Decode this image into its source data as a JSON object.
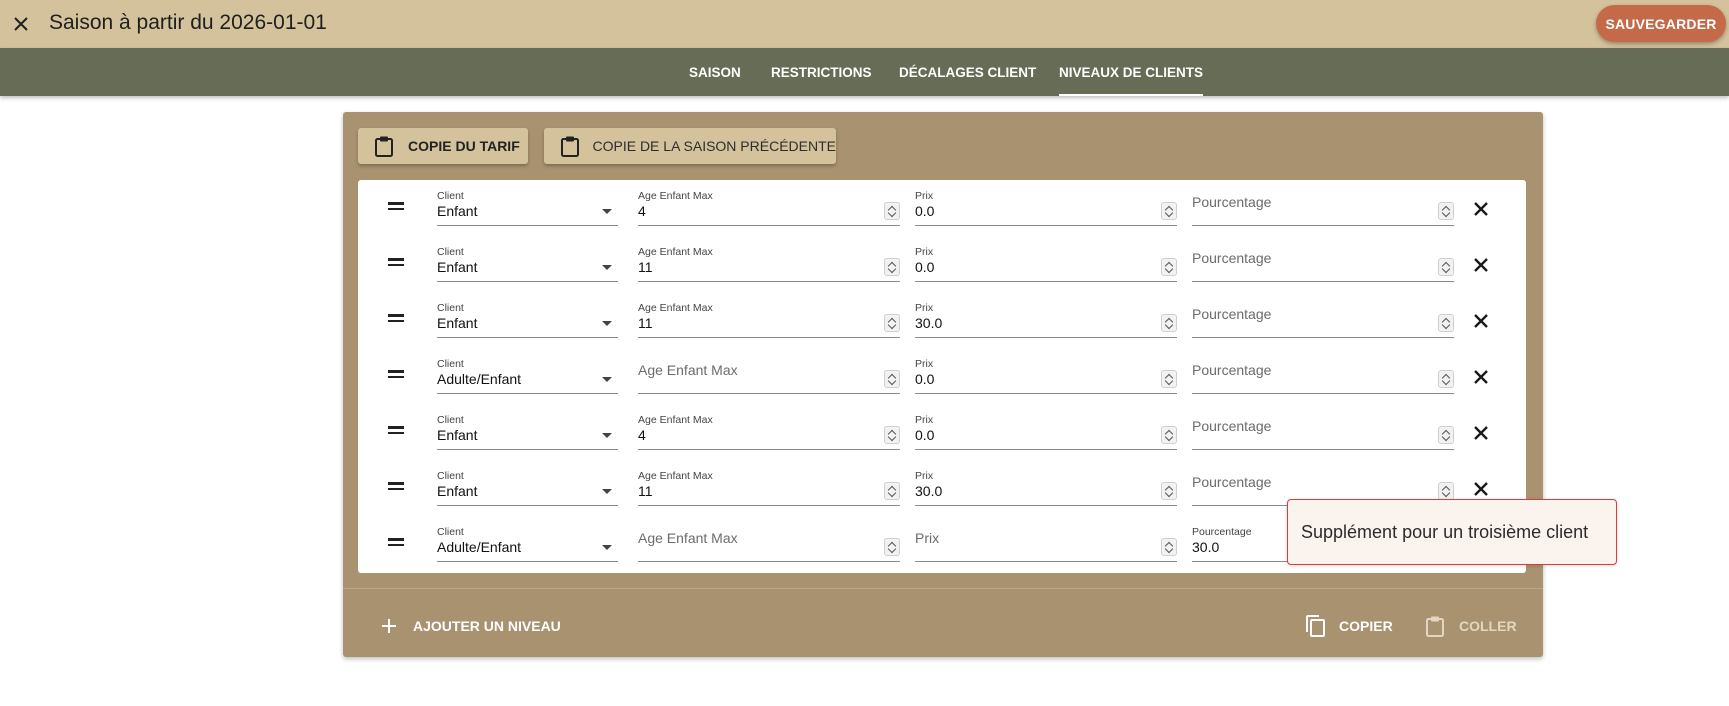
{
  "header": {
    "title": "Saison à partir du 2026-01-01",
    "save_label": "SAUVEGARDER",
    "colors": {
      "header_bg": "#d4c29c",
      "save_bg": "#c46a49",
      "tabbar_bg": "#666c55",
      "panel_bg": "#a89270"
    }
  },
  "tabs": [
    {
      "label": "SAISON",
      "active": false
    },
    {
      "label": "RESTRICTIONS",
      "active": false
    },
    {
      "label": "DÉCALAGES CLIENT",
      "active": false
    },
    {
      "label": "NIVEAUX DE CLIENTS",
      "active": true
    }
  ],
  "toolbar": {
    "copy_tariff_label": "COPIE DU TARIF",
    "copy_prev_season_label": "COPIE DE LA SAISON PRÉCÉDENTE"
  },
  "labels": {
    "client": "Client",
    "age": "Age Enfant Max",
    "prix": "Prix",
    "pct": "Pourcentage"
  },
  "rows": [
    {
      "client": "Enfant",
      "age": "4",
      "prix": "0.0",
      "pct": ""
    },
    {
      "client": "Enfant",
      "age": "11",
      "prix": "0.0",
      "pct": ""
    },
    {
      "client": "Enfant",
      "age": "11",
      "prix": "30.0",
      "pct": ""
    },
    {
      "client": "Adulte/Enfant",
      "age": "",
      "prix": "0.0",
      "pct": ""
    },
    {
      "client": "Enfant",
      "age": "4",
      "prix": "0.0",
      "pct": ""
    },
    {
      "client": "Enfant",
      "age": "11",
      "prix": "30.0",
      "pct": ""
    },
    {
      "client": "Adulte/Enfant",
      "age": "",
      "prix": "",
      "pct": "30.0"
    }
  ],
  "footer": {
    "add_level_label": "AJOUTER UN NIVEAU",
    "copy_label": "COPIER",
    "paste_label": "COLLER"
  },
  "tooltip": {
    "text": "Supplément pour un troisième client"
  }
}
